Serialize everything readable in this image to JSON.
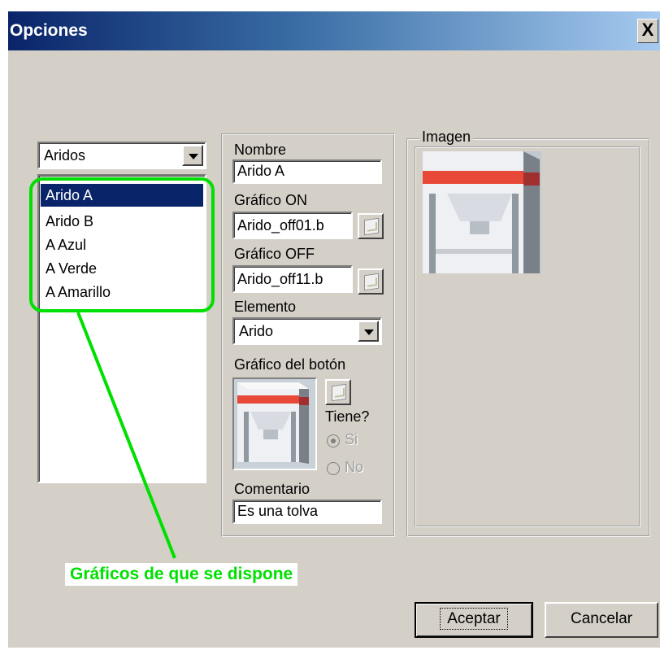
{
  "window": {
    "title": "Opciones",
    "close_label": "X"
  },
  "category": {
    "selected": "Aridos"
  },
  "list": {
    "items": [
      "Arido A",
      "Arido B",
      "A Azul",
      "A Verde",
      "A Amarillo"
    ],
    "selected_index": 0
  },
  "form": {
    "nombre_label": "Nombre",
    "nombre_value": "Arido A",
    "grafico_on_label": "Gráfico ON",
    "grafico_on_value": "Arido_off01.b",
    "grafico_off_label": "Gráfico OFF",
    "grafico_off_value": "Arido_off11.b",
    "elemento_label": "Elemento",
    "elemento_value": "Arido",
    "grafico_boton_label": "Gráfico del botón",
    "tiene_label": "Tiene?",
    "radio_si": "Si",
    "radio_no": "No",
    "radio_selected": "Si",
    "comentario_label": "Comentario",
    "comentario_value": "Es una tolva"
  },
  "imagen": {
    "label": "Imagen"
  },
  "annotation": {
    "text": "Gráficos de que se dispone",
    "color": "#00e000"
  },
  "buttons": {
    "accept": "Aceptar",
    "cancel": "Cancelar"
  },
  "icons": {
    "browse": "browse-file-icon",
    "dropdown": "chevron-down-icon",
    "close": "close-icon"
  }
}
